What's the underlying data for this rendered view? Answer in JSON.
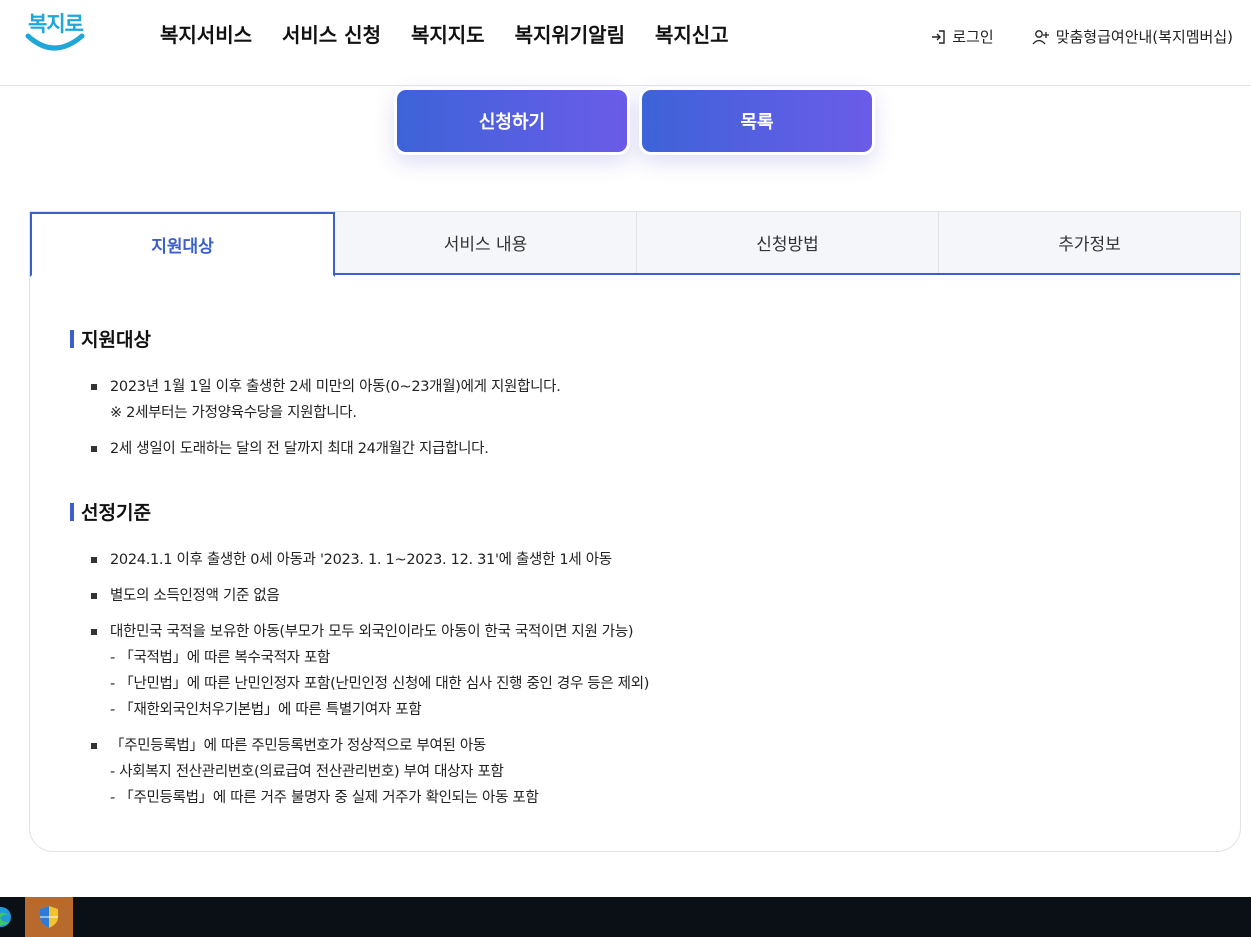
{
  "header": {
    "logo_text": "복지로",
    "nav": [
      "복지서비스",
      "서비스 신청",
      "복지지도",
      "복지위기알림",
      "복지신고"
    ],
    "login_label": "로그인",
    "membership_label": "맞춤형급여안내(복지멤버십)"
  },
  "actions": {
    "apply_label": "신청하기",
    "list_label": "목록"
  },
  "tabs": [
    {
      "label": "지원대상",
      "active": true
    },
    {
      "label": "서비스 내용",
      "active": false
    },
    {
      "label": "신청방법",
      "active": false
    },
    {
      "label": "추가정보",
      "active": false
    }
  ],
  "sections": [
    {
      "title": "지원대상",
      "items": [
        {
          "lines": [
            "2023년 1월 1일 이후 출생한 2세 미만의 아동(0~23개월)에게 지원합니다.",
            "※ 2세부터는 가정양육수당을 지원합니다."
          ]
        },
        {
          "lines": [
            "2세 생일이 도래하는 달의 전 달까지 최대 24개월간 지급합니다."
          ]
        }
      ]
    },
    {
      "title": "선정기준",
      "items": [
        {
          "lines": [
            "2024.1.1 이후 출생한 0세 아동과 '2023. 1. 1~2023. 12. 31'에 출생한 1세 아동"
          ]
        },
        {
          "lines": [
            "별도의 소득인정액 기준 없음"
          ]
        },
        {
          "lines": [
            "대한민국 국적을 보유한 아동(부모가 모두 외국인이라도 아동이 한국 국적이면 지원 가능)",
            "- 「국적법」에 따른 복수국적자 포함",
            "- 「난민법」에 따른 난민인정자 포함(난민인정 신청에 대한 심사 진행 중인 경우 등은 제외)",
            "- 「재한외국인처우기본법」에 따른 특별기여자 포함"
          ]
        },
        {
          "lines": [
            "「주민등록법」에 따른 주민등록번호가 정상적으로 부여된 아동",
            "- 사회복지 전산관리번호(의료급여 전산관리번호) 부여 대상자 포함",
            "- 「주민등록법」에 따른 거주 불명자 중 실제 거주가 확인되는 아동 포함"
          ]
        }
      ]
    }
  ],
  "colors": {
    "accent": "#3d5fc8",
    "button_gradient_start": "#3d63d8",
    "button_gradient_end": "#6b5ce8",
    "logo": "#1ea7d7",
    "taskbar": "#0b1017",
    "taskbar_app": "#b86a2c"
  },
  "icons": {
    "login": "login-icon",
    "membership": "user-plus-icon",
    "taskbar_browser": "edge-icon",
    "taskbar_app": "shield-icon"
  }
}
